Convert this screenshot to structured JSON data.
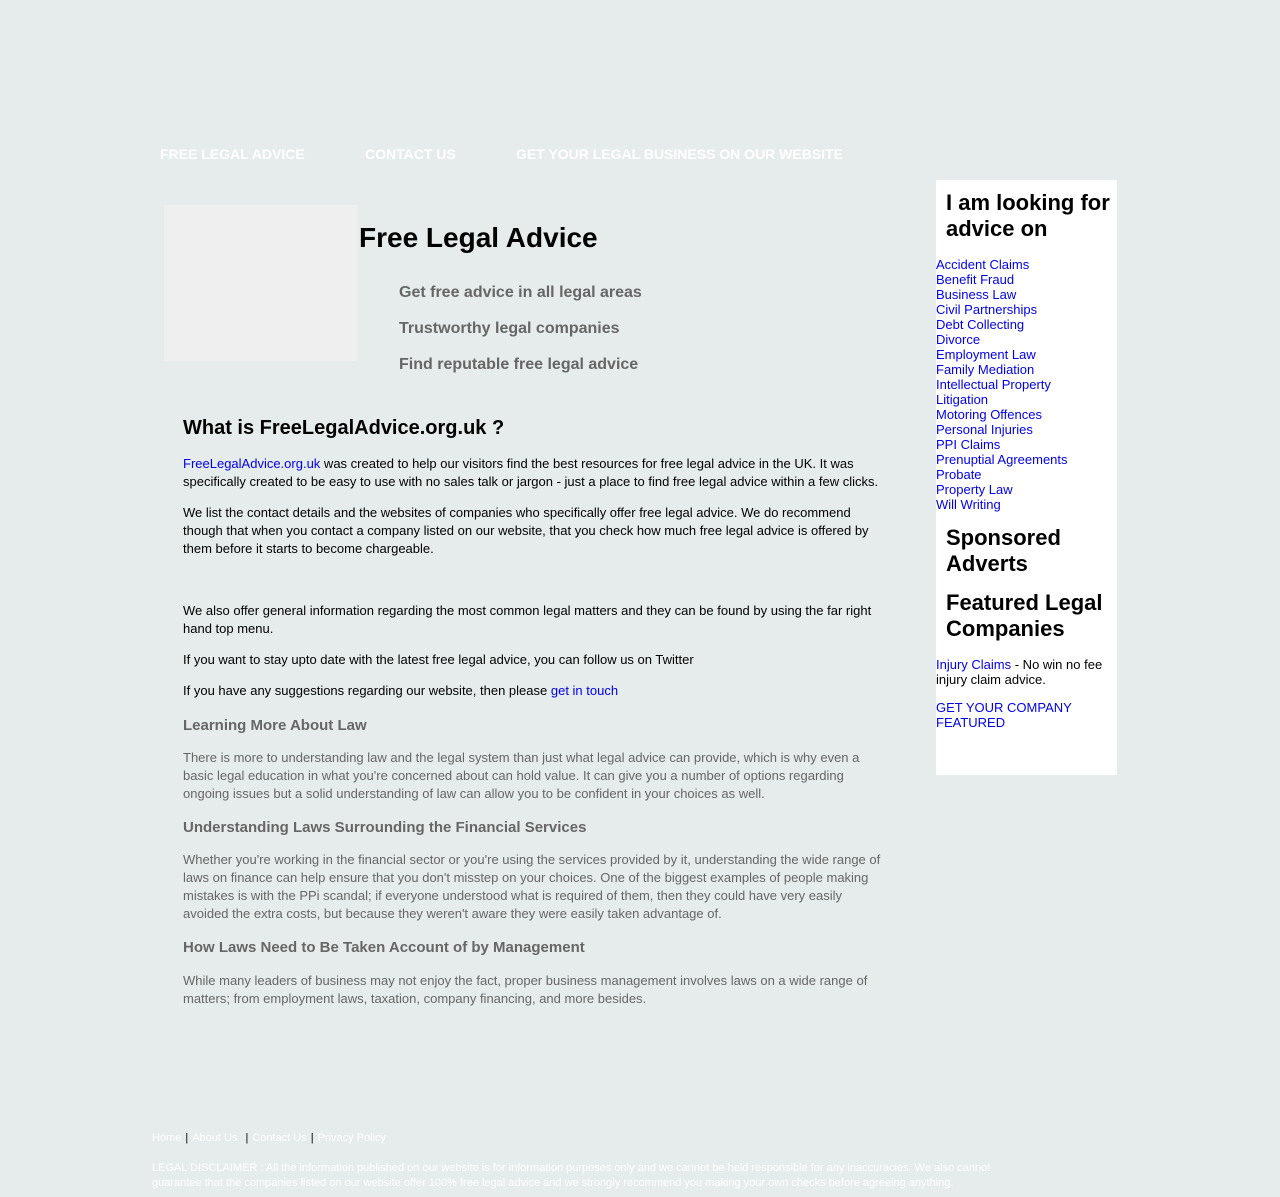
{
  "nav": {
    "free_legal_advice": "FREE LEGAL ADVICE",
    "contact_us": "CONTACT US",
    "get_business": "GET YOUR LEGAL BUSINESS ON OUR WEBSITE"
  },
  "hero": {
    "title": "Free Legal Advice",
    "lines": [
      "Get free advice in all legal areas",
      "Trustworthy legal companies",
      "Find reputable free legal advice"
    ]
  },
  "main": {
    "what_heading": "What is FreeLegalAdvice.org.uk ?",
    "intro_link": "FreeLegalAdvice.org.uk",
    "intro_text": " was created to help our visitors find the best resources for free legal advice in the UK. It was specifically created to be easy to use with no sales talk or jargon - just a place to find free legal advice within a few clicks.",
    "list_text": "We list the contact details and the websites of companies who specifically offer free legal advice. We do recommend though that when you contact a company listed on our website, that you check how much free legal advice is offered by them before it starts to become chargeable.",
    "info_text": "We also offer general information regarding the most common legal matters and they can be found by using the far right hand top menu.",
    "twitter_text": "If you want to stay upto date with the latest free legal advice, you can follow us on Twitter",
    "suggest_text": "If you have any suggestions regarding our website, then please ",
    "suggest_link": "get in touch",
    "learning_heading": "Learning More About Law",
    "learning_text": "There is more to understanding law and the legal system than just what legal advice can provide, which is why even a basic legal education in what you're concerned about can hold value. It can give you a number of options regarding ongoing issues but a solid understanding of law can allow you to be confident in your choices as well.",
    "financial_heading": "Understanding Laws Surrounding the Financial Services",
    "financial_text": "Whether you're working in the financial sector or you're using the services provided by it, understanding the wide range of laws on finance can help ensure that you don't misstep on your choices. One of the biggest examples of people making mistakes is with the PPi scandal; if everyone understood what is required of them, then they could have very easily avoided the extra costs, but because they weren't aware they were easily taken advantage of.",
    "management_heading": "How Laws Need to Be Taken Account of by Management",
    "management_text": "While many leaders of business may not enjoy the fact, proper business management involves laws on a wide range of matters; from employment laws, taxation, company financing, and more besides."
  },
  "sidebar": {
    "looking_heading": "I am looking for advice on",
    "topics": [
      "Accident Claims",
      "Benefit Fraud",
      "Business Law",
      "Civil Partnerships",
      "Debt Collecting",
      "Divorce",
      "Employment Law",
      "Family Mediation",
      "Intellectual Property",
      "Litigation",
      "Motoring Offences",
      "Personal Injuries",
      "PPI Claims",
      "Prenuptial Agreements",
      "Probate",
      "Property Law",
      "Will Writing"
    ],
    "sponsored_heading": "Sponsored Adverts",
    "featured_heading": "Featured Legal Companies",
    "injury_link": "Injury Claims",
    "injury_text": " - No win no fee injury claim advice.",
    "get_featured": "GET YOUR COMPANY FEATURED"
  },
  "footer": {
    "home": "Home",
    "about": "About Us",
    "contact": "Contact Us",
    "privacy": "Privacy Policy",
    "separator": "|",
    "disclaimer": "LEGAL DISCLAIMER : All the information published on our website is for information purposes only and we cannot be held responsible for any inaccuracies. We also cannot guarantee that the companies listed on our website offer 100% free legal advice and we strongly recommend you making your own checks before agreeing anything."
  }
}
